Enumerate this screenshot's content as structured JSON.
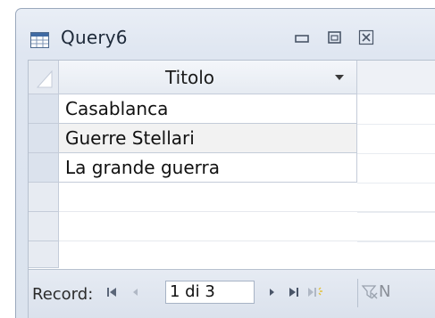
{
  "window": {
    "title": "Query6"
  },
  "datasheet": {
    "column_header": "Titolo",
    "rows": [
      "Casablanca",
      "Guerre Stellari",
      "La grande guerra"
    ]
  },
  "navigation": {
    "record_label": "Record:",
    "record_position": "1 di 3",
    "filter_initial": "N"
  },
  "colors": {
    "window_frame": "#dfe6f1",
    "selector": "#dbe2ed",
    "alt_row": "#f2f2f2"
  }
}
